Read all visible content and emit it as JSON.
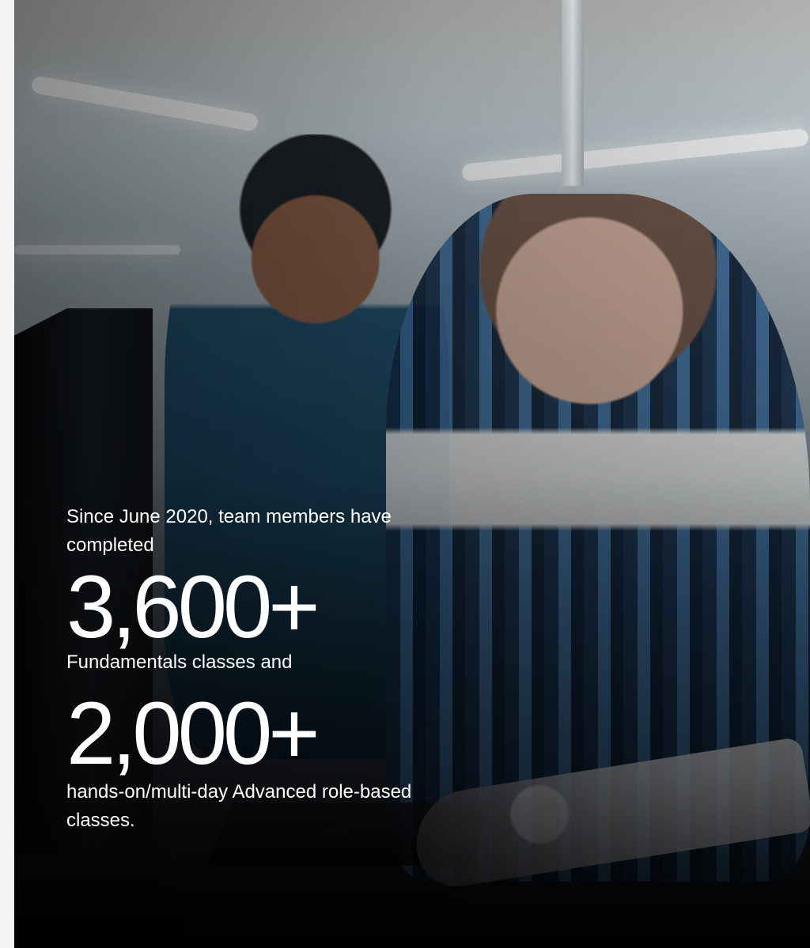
{
  "stats_panel": {
    "intro": "Since June 2020, team members have completed",
    "fundamentals_count": "3,600+",
    "fundamentals_label": "Fundamentals classes and",
    "advanced_count": "2,000+",
    "advanced_label": "hands-on/multi-day Advanced role-based classes."
  },
  "colors": {
    "text": "#ffffff",
    "page_background": "#f3f3f3",
    "image_dark": "#080a0e",
    "shirt_blue": "#1c4d6b"
  }
}
